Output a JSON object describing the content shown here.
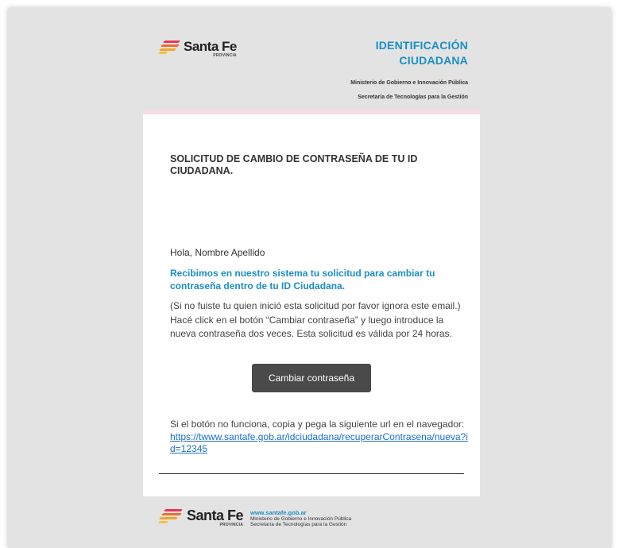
{
  "header": {
    "brand": "Santa Fe",
    "brand_sub": "PROVINCIA",
    "title_line1": "IDENTIFICACIÓN",
    "title_line2": "CIUDADANA",
    "ministry": "Ministerio de Gobierno e Innovación Pública",
    "secretariat": "Secretaría de Tecnologías para la Gestión"
  },
  "email": {
    "heading": "SOLICITUD DE CAMBIO DE CONTRASEÑA DE TU ID CIUDADANA.",
    "greeting": "Hola, Nombre Apellido",
    "highlight": "Recibimos en nuestro sistema tu solicitud para cambiar tu contraseña dentro de tu ID Ciudadana.",
    "body": "(Si no fuiste tu quien inició esta solicitud por favor ignora este email.) Hacé click en el botón “Cambiar contraseña” y luego introduce la nueva contraseña dos veces. Esta solicitud es válida por 24 horas.",
    "button_label": "Cambiar contraseña",
    "fallback_text": "Si el botón no funciona, copia y pega la siguiente url en el navegador:",
    "fallback_url": "https://twww.santafe.gob.ar/idciudadana/recuperarContrasena/nueva?id=12345"
  },
  "footer": {
    "brand": "Santa Fe",
    "brand_sub": "PROVINCIA",
    "website": "www.santafe.gob.ar",
    "ministry": "Ministerio de Gobierno e Innovación Pública",
    "secretariat": "Secretaría de Tecnologías para la Gestión"
  },
  "colors": {
    "accent": "#1a8fc4",
    "button": "#4a4a4a",
    "background": "#e3e3e3",
    "strip": "#f8dce6"
  }
}
